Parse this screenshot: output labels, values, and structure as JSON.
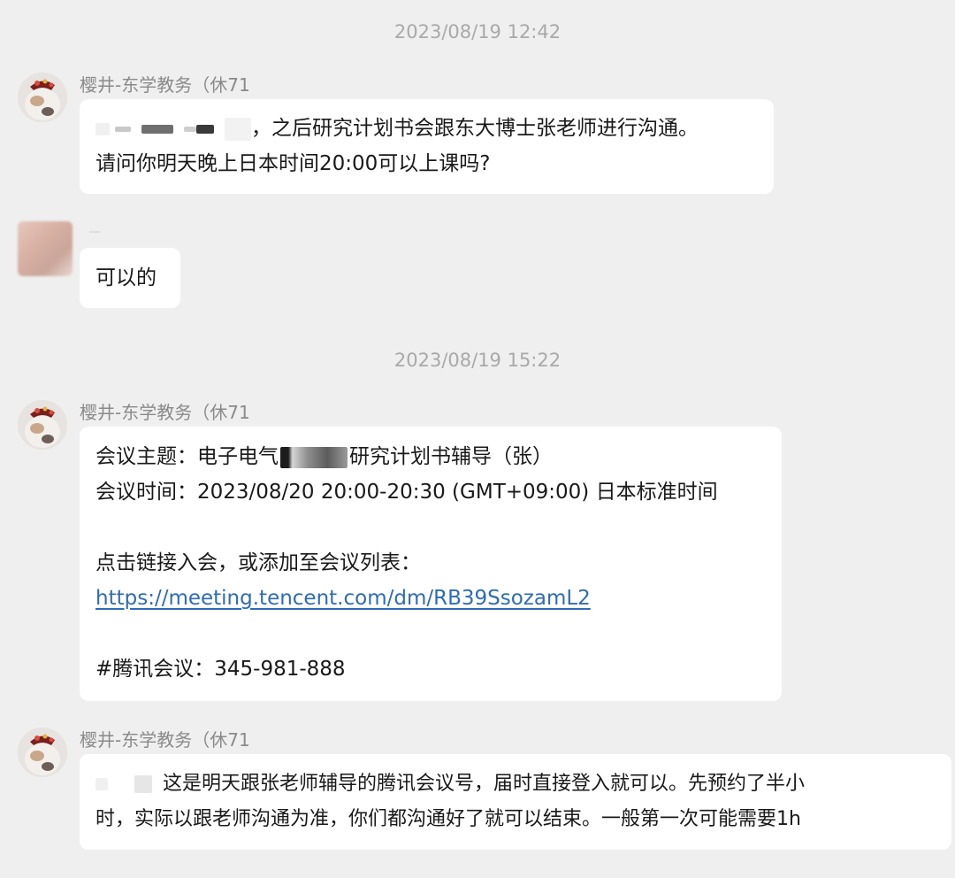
{
  "timestamps": [
    "2023/08/19 12:42",
    "2023/08/19 15:22"
  ],
  "sender_name": "樱井-东学教务（休71",
  "other_sender_name": "—",
  "messages": {
    "m1": {
      "line1_text": "，之后研究计划书会跟东大博士张老师进行沟通。",
      "line2": "请问你明天晚上日本时间20:00可以上课吗?"
    },
    "m2": {
      "text": "可以的"
    },
    "m3": {
      "topic_prefix": "会议主题：电子电气",
      "topic_suffix": "研究计划书辅导（张）",
      "time": "会议时间：2023/08/20 20:00-20:30 (GMT+09:00) 日本标准时间",
      "join_hint": "点击链接入会，或添加至会议列表：",
      "link": "https://meeting.tencent.com/dm/RB39SsozamL2",
      "meeting_id": "#腾讯会议：345-981-888"
    },
    "m4": {
      "line1_text": "这是明天跟张老师辅导的腾讯会议号，届时直接登入就可以。先预约了半小",
      "line2": "时，实际以跟老师沟通为准，你们都沟通好了就可以结束。一般第一次可能需要1h"
    }
  },
  "icons": {
    "sender_avatar": "cat-avatar-icon",
    "other_avatar": "blurred-avatar-icon"
  },
  "colors": {
    "background": "#efefef",
    "bubble": "#ffffff",
    "link": "#2f6bb7",
    "meta_text": "#a9a9a9"
  }
}
